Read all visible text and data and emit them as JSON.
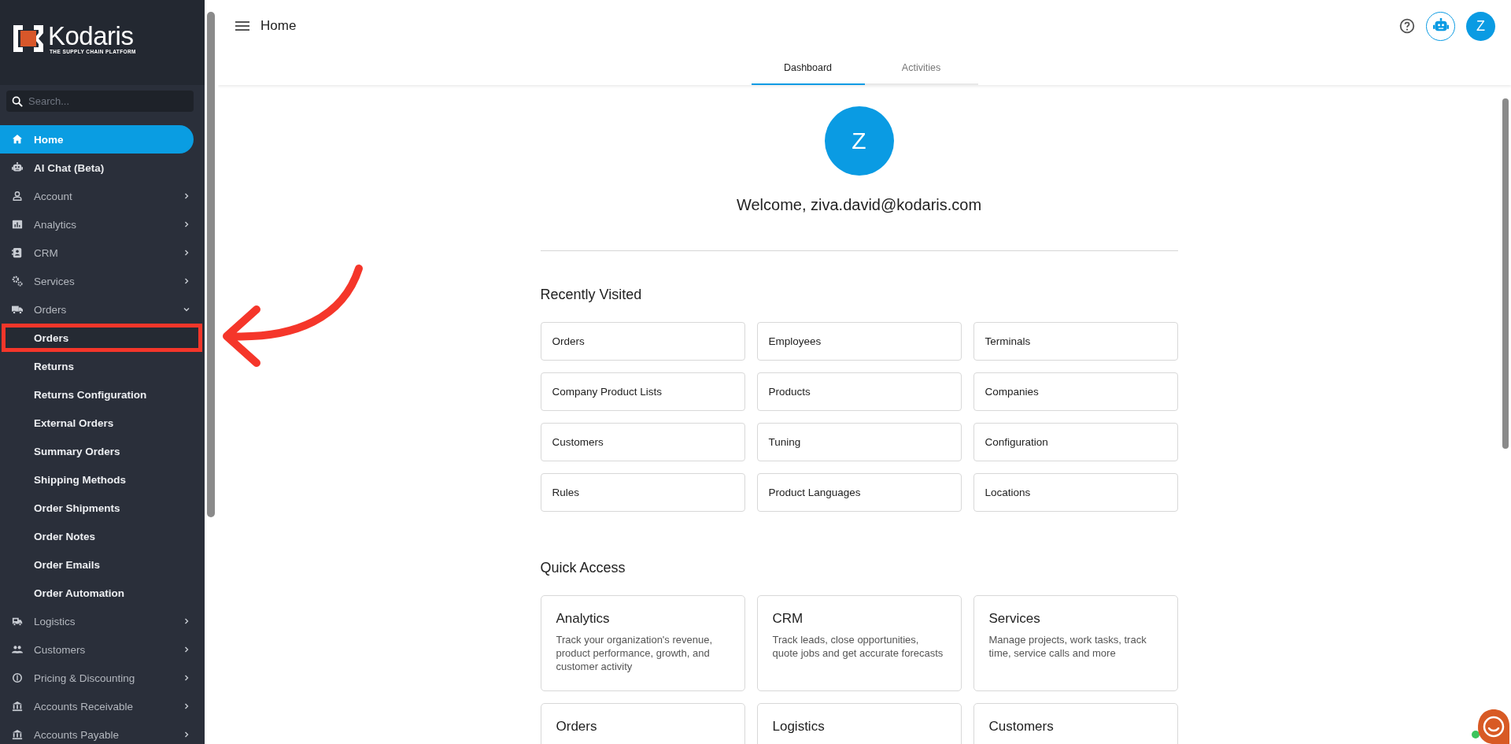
{
  "sidebar": {
    "logo": {
      "name": "Kodaris",
      "tagline": "THE SUPPLY CHAIN PLATFORM"
    },
    "search": {
      "placeholder": "Search..."
    },
    "items": [
      {
        "label": "Home",
        "selected": true
      },
      {
        "label": "AI Chat (Beta)",
        "selected": false
      },
      {
        "label": "Account",
        "selected": false,
        "expanded": false
      },
      {
        "label": "Analytics",
        "selected": false,
        "expanded": false
      },
      {
        "label": "CRM",
        "selected": false,
        "expanded": false
      },
      {
        "label": "Services",
        "selected": false,
        "expanded": false
      },
      {
        "label": "Orders",
        "selected": false,
        "expanded": true,
        "children": [
          {
            "label": "Orders",
            "selected": false,
            "highlighted": true
          },
          {
            "label": "Returns",
            "selected": false,
            "highlighted": false
          },
          {
            "label": "Returns Configuration",
            "selected": false,
            "highlighted": false
          },
          {
            "label": "External Orders",
            "selected": false,
            "highlighted": false
          },
          {
            "label": "Summary Orders",
            "selected": false,
            "highlighted": false
          },
          {
            "label": "Shipping Methods",
            "selected": false,
            "highlighted": false
          },
          {
            "label": "Order Shipments",
            "selected": false,
            "highlighted": false
          },
          {
            "label": "Order Notes",
            "selected": false,
            "highlighted": false
          },
          {
            "label": "Order Emails",
            "selected": false,
            "highlighted": false
          },
          {
            "label": "Order Automation",
            "selected": false,
            "highlighted": false
          }
        ]
      },
      {
        "label": "Logistics",
        "selected": false,
        "expanded": false
      },
      {
        "label": "Customers",
        "selected": false,
        "expanded": false
      },
      {
        "label": "Pricing & Discounting",
        "selected": false,
        "expanded": false
      },
      {
        "label": "Accounts Receivable",
        "selected": false,
        "expanded": false
      },
      {
        "label": "Accounts Payable",
        "selected": false,
        "expanded": false
      }
    ]
  },
  "header": {
    "title": "Home",
    "avatar": "Z"
  },
  "tabs": [
    {
      "label": "Dashboard",
      "selected": true
    },
    {
      "label": "Activities",
      "selected": false
    }
  ],
  "welcome": {
    "avatar": "Z",
    "text": "Welcome, ziva.david@kodaris.com"
  },
  "recently_visited": {
    "title": "Recently Visited",
    "items": [
      "Orders",
      "Employees",
      "Terminals",
      "Company Product Lists",
      "Products",
      "Companies",
      "Customers",
      "Tuning",
      "Configuration",
      "Rules",
      "Product Languages",
      "Locations"
    ]
  },
  "quick_access": {
    "title": "Quick Access",
    "cards": [
      {
        "title": "Analytics",
        "description": "Track your organization's revenue, product performance, growth, and customer activity"
      },
      {
        "title": "CRM",
        "description": "Track leads, close opportunities, quote jobs and get accurate forecasts"
      },
      {
        "title": "Services",
        "description": "Manage projects, work tasks, track time, service calls and more"
      },
      {
        "title": "Orders"
      },
      {
        "title": "Logistics"
      },
      {
        "title": "Customers"
      }
    ]
  },
  "callout": {
    "kind": "curved-arrow"
  }
}
